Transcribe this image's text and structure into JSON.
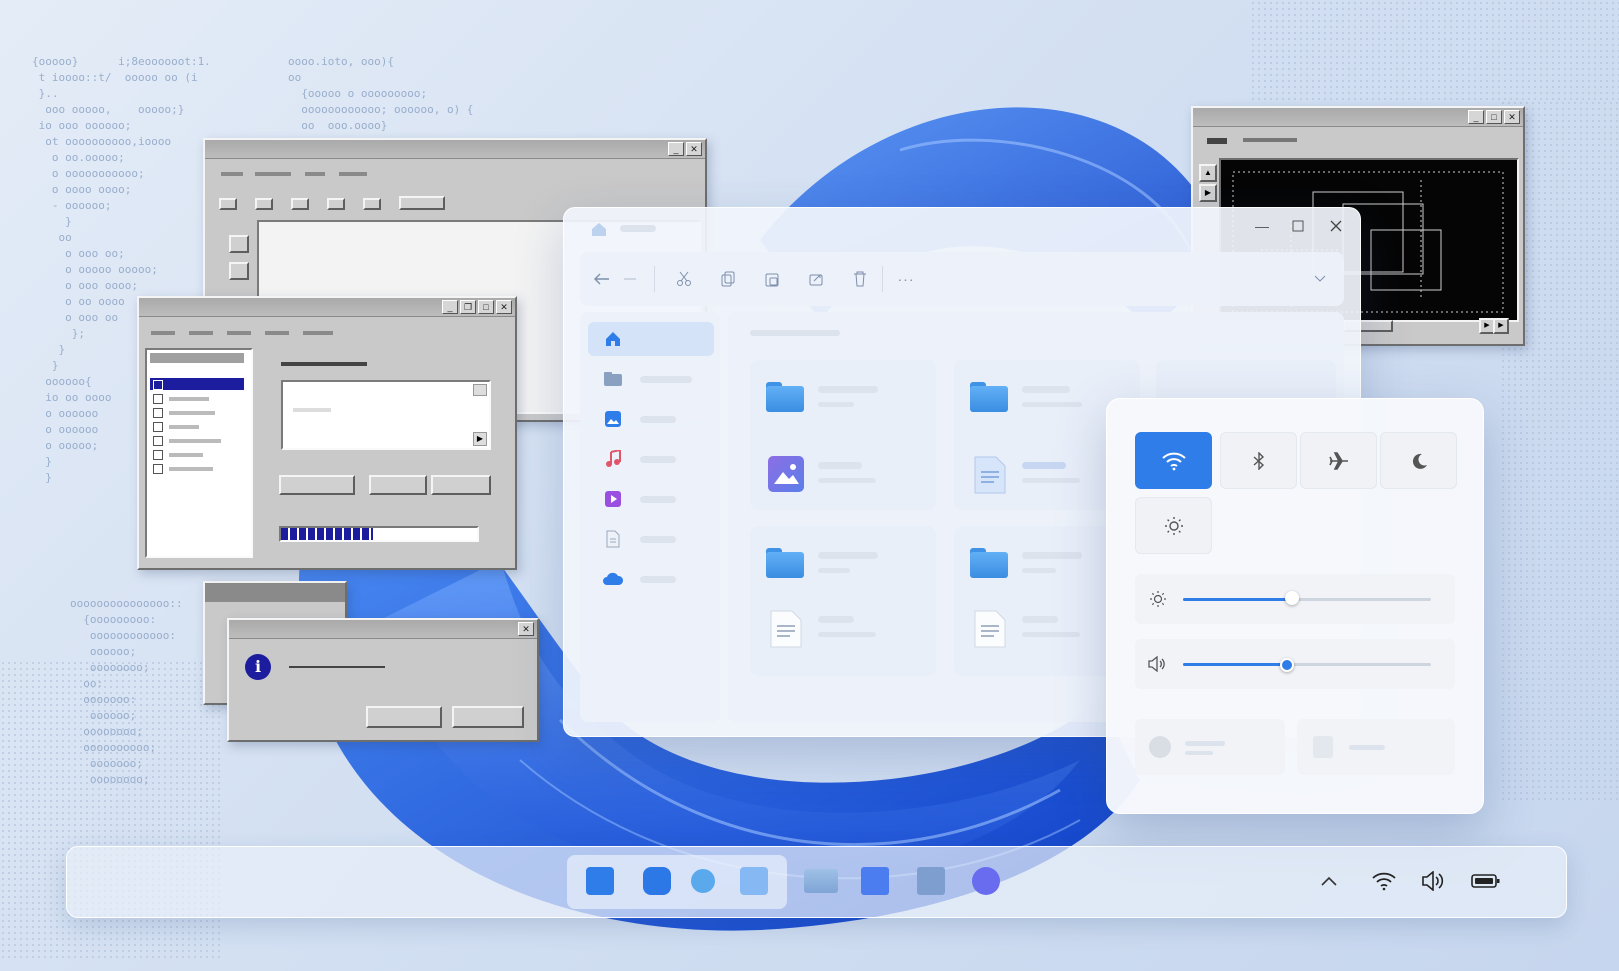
{
  "theme": {
    "accent": "#2f7de8",
    "folder": "#4a9be8",
    "retro_title_active": "#1c1c9e"
  },
  "explorer": {
    "nav_icons": [
      "back-arrow-icon",
      "forward-arrow-icon",
      "cut-icon",
      "copy-icon",
      "paste-icon",
      "share-icon",
      "delete-icon",
      "more-icon"
    ],
    "sidebar_icons": [
      "home-icon",
      "folder-icon",
      "pictures-icon",
      "music-icon",
      "videos-icon",
      "documents-icon",
      "cloud-icon"
    ],
    "items": [
      "folder-icon",
      "folder-icon",
      "image-file-icon",
      "document-file-icon",
      "folder-icon",
      "folder-icon",
      "document-file-icon",
      "document-file-icon"
    ]
  },
  "quick_settings": {
    "toggles": [
      {
        "icon": "wifi-icon",
        "active": true
      },
      {
        "icon": "bluetooth-icon",
        "active": false
      },
      {
        "icon": "airplane-icon",
        "active": false
      },
      {
        "icon": "moon-icon",
        "active": false
      },
      {
        "icon": "brightness-icon",
        "active": false
      }
    ],
    "brightness_level": 0.44,
    "volume_level": 0.42
  },
  "retro": {
    "progress_fraction": 0.47,
    "info_icon_label": "i"
  },
  "taskbar": {
    "apps": [
      "start-app",
      "app-2",
      "app-3",
      "app-4",
      "app-5",
      "app-6",
      "app-7",
      "app-8"
    ],
    "tray": [
      "chevron-up-icon",
      "wifi-icon",
      "speaker-icon",
      "battery-icon"
    ]
  }
}
